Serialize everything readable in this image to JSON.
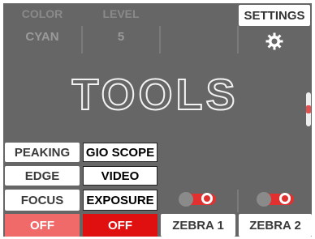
{
  "header": {
    "color_label": "COLOR",
    "color_value": "CYAN",
    "level_label": "LEVEL",
    "level_value": "5",
    "settings_label": "SETTINGS",
    "settings_icon": "gear-icon"
  },
  "main": {
    "title": "TOOLS"
  },
  "buttons_left": [
    {
      "label": "PEAKING"
    },
    {
      "label": "EDGE"
    },
    {
      "label": "FOCUS"
    },
    {
      "label": "OFF"
    }
  ],
  "buttons_mid": [
    {
      "label": "GIO SCOPE"
    },
    {
      "label": "VIDEO"
    },
    {
      "label": "EXPOSURE"
    },
    {
      "label": "OFF"
    }
  ],
  "zebra": [
    {
      "label": "ZEBRA 1",
      "state": "on"
    },
    {
      "label": "ZEBRA 2",
      "state": "on"
    }
  ],
  "colors": {
    "panel": "#666666",
    "off_light": "#f06a6a",
    "off_dark": "#e01010",
    "accent_red": "#e03030"
  }
}
